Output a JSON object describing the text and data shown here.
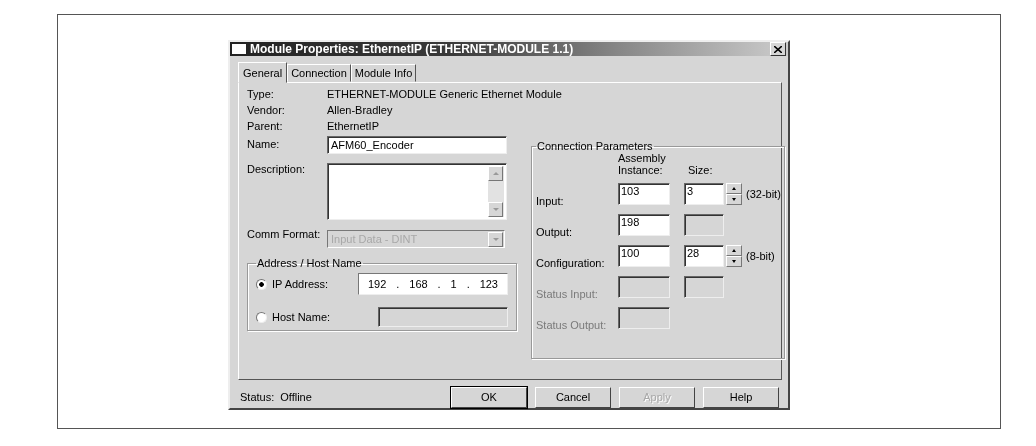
{
  "window": {
    "title": "Module Properties: EthernetIP (ETHERNET-MODULE 1.1)"
  },
  "tabs": [
    {
      "label": "General",
      "selected": true
    },
    {
      "label": "Connection",
      "selected": false
    },
    {
      "label": "Module Info",
      "selected": false
    }
  ],
  "info": [
    {
      "label": "Type:",
      "value": "ETHERNET-MODULE Generic Ethernet Module"
    },
    {
      "label": "Vendor:",
      "value": "Allen-Bradley"
    },
    {
      "label": "Parent:",
      "value": "EthernetIP"
    }
  ],
  "name_field": {
    "label": "Name:",
    "value": "AFM60_Encoder"
  },
  "description": {
    "label": "Description:"
  },
  "comm_format": {
    "label": "Comm Format:",
    "value": "Input Data - DINT",
    "disabled": true
  },
  "address": {
    "title": "Address / Host Name",
    "options": [
      {
        "label": "IP Address:",
        "selected": true,
        "kind": "ip",
        "octets": [
          "192",
          "168",
          "1",
          "123"
        ],
        "separator": "."
      },
      {
        "label": "Host Name:",
        "selected": false,
        "kind": "text"
      }
    ]
  },
  "connection_parameters": {
    "title": "Connection Parameters",
    "headers": [
      "Assembly Instance:",
      "Size:"
    ],
    "rows": [
      {
        "label": "Input:",
        "disabled": false,
        "instance": "103",
        "kind": "spin",
        "size": "3",
        "unit": "(32-bit)"
      },
      {
        "label": "Output:",
        "disabled": false,
        "instance": "198",
        "kind": "box"
      },
      {
        "label": "Configuration:",
        "disabled": false,
        "instance": "100",
        "kind": "spin",
        "size": "28",
        "unit": "(8-bit)"
      },
      {
        "label": "Status Input:",
        "disabled": true,
        "kind": "box"
      },
      {
        "label": "Status Output:",
        "disabled": true,
        "kind": "none"
      }
    ]
  },
  "status": {
    "label": "Status:",
    "value": "Offline"
  },
  "buttons": [
    {
      "label": "OK",
      "default": true,
      "disabled": false
    },
    {
      "label": "Cancel",
      "default": false,
      "disabled": false
    },
    {
      "label": "Apply",
      "default": false,
      "disabled": true
    },
    {
      "label": "Help",
      "default": false,
      "disabled": false
    }
  ]
}
